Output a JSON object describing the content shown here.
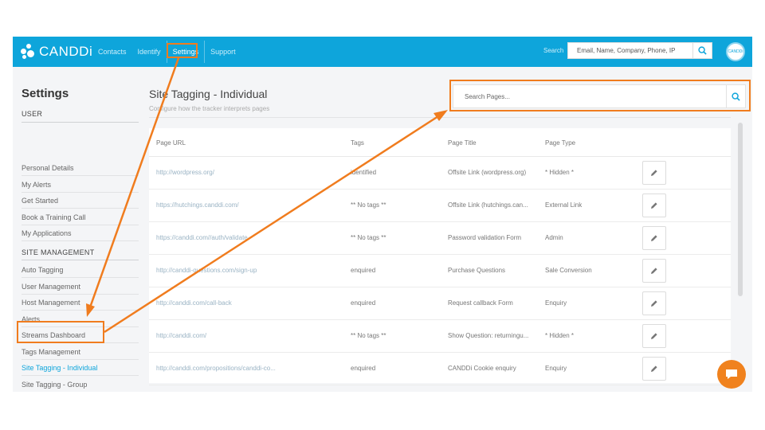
{
  "brand": {
    "name": "CANDDi",
    "accent": "#0ea5db",
    "annotation": "#f07c1e"
  },
  "nav": {
    "items": [
      {
        "label": "Contacts"
      },
      {
        "label": "Identify"
      },
      {
        "label": "Settings"
      },
      {
        "label": "Support"
      }
    ],
    "active": "Settings",
    "search_label": "Search",
    "search_placeholder": "Email, Name, Company, Phone, IP",
    "avatar_text": "CANDDi"
  },
  "sidebar": {
    "title": "Settings",
    "user_heading": "USER",
    "user_items": [
      {
        "label": "Personal Details"
      },
      {
        "label": "My Alerts"
      },
      {
        "label": "Get Started"
      },
      {
        "label": "Book a Training Call"
      },
      {
        "label": "My Applications"
      }
    ],
    "site_heading": "SITE MANAGEMENT",
    "site_items": [
      {
        "label": "Auto Tagging"
      },
      {
        "label": "User Management"
      },
      {
        "label": "Host Management"
      },
      {
        "label": "Alerts"
      },
      {
        "label": "Streams Dashboard"
      },
      {
        "label": "Tags Management"
      },
      {
        "label": "Site Tagging - Individual"
      },
      {
        "label": "Site Tagging - Group"
      }
    ],
    "active": "Site Tagging - Individual"
  },
  "main": {
    "title": "Site Tagging - Individual",
    "subtitle": "Configure how the tracker interprets pages",
    "search_placeholder": "Search Pages..."
  },
  "table": {
    "columns": [
      "Page URL",
      "Tags",
      "Page Title",
      "Page Type"
    ],
    "rows": [
      {
        "url": "http://wordpress.org/",
        "tags": "identified",
        "title": "Offsite Link (wordpress.org)",
        "type": "* Hidden *"
      },
      {
        "url": "https://hutchings.canddi.com/",
        "tags": "** No tags **",
        "title": "Offsite Link (hutchings.can...",
        "type": "External Link"
      },
      {
        "url": "https://canddi.com//auth/validate",
        "tags": "** No tags **",
        "title": "Password validation Form",
        "type": "Admin"
      },
      {
        "url": "http://canddi-questions.com/sign-up",
        "tags": "enquired",
        "title": "Purchase Questions",
        "type": "Sale Conversion"
      },
      {
        "url": "http://canddi.com/call-back",
        "tags": "enquired",
        "title": "Request callback Form",
        "type": "Enquiry"
      },
      {
        "url": "http://canddi.com/",
        "tags": "** No tags **",
        "title": "Show Question: returningu...",
        "type": "* Hidden *"
      },
      {
        "url": "http://canddi.com/propositions/canddi-co...",
        "tags": "enquired",
        "title": "CANDDi Cookie enquiry",
        "type": "Enquiry"
      }
    ]
  },
  "icons": {
    "search": "search-icon",
    "edit": "pencil-icon",
    "chat": "chat-icon"
  }
}
